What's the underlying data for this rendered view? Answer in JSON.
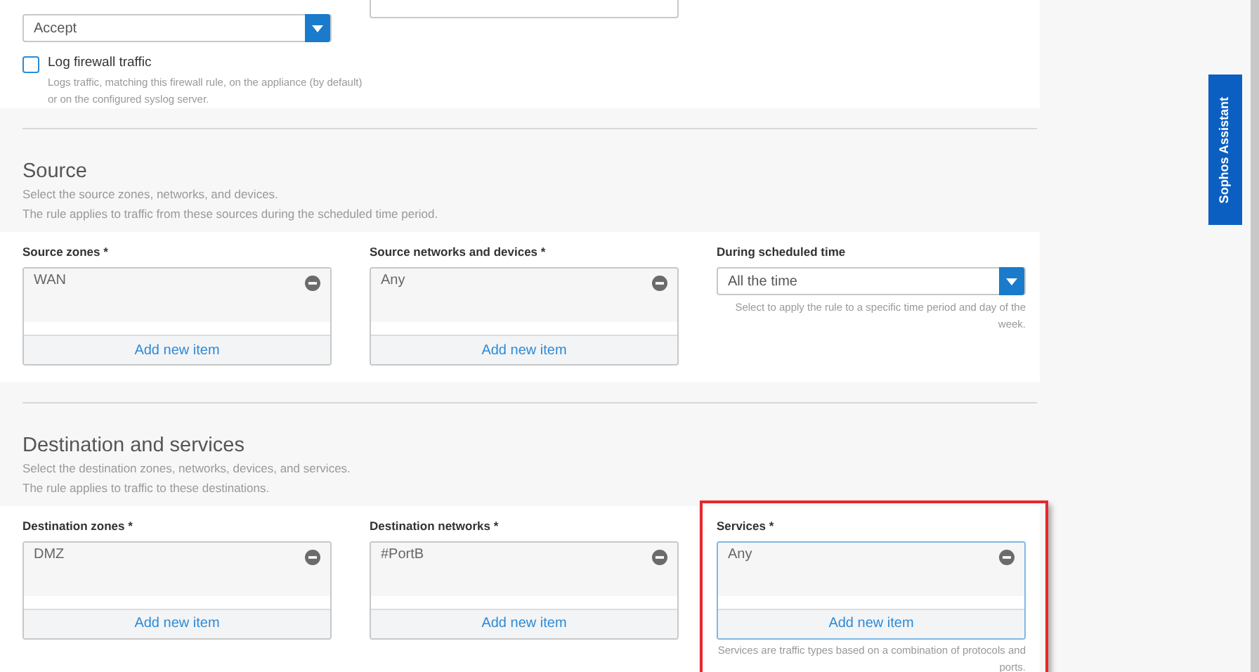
{
  "action": {
    "value": "Accept"
  },
  "log_traffic": {
    "label": "Log firewall traffic",
    "checked": false,
    "help": "Logs traffic, matching this firewall rule, on the appliance (by default) or on the configured syslog server."
  },
  "sections": [
    {
      "title": "Source",
      "description": [
        "Select the source zones, networks, and devices.",
        "The rule applies to traffic from these sources during the scheduled time period."
      ],
      "fields": [
        {
          "kind": "list",
          "label": "Source zones *",
          "items": [
            "WAN"
          ],
          "add": "Add new item",
          "highlighted": false
        },
        {
          "kind": "list",
          "label": "Source networks and devices *",
          "items": [
            "Any"
          ],
          "add": "Add new item",
          "highlighted": false
        },
        {
          "kind": "select",
          "label": "During scheduled time",
          "value": "All the time",
          "help": "Select to apply the rule to a specific time period and day of the week."
        }
      ]
    },
    {
      "title": "Destination and services",
      "description": [
        "Select the destination zones, networks, devices, and services.",
        "The rule applies to traffic to these destinations."
      ],
      "fields": [
        {
          "kind": "list",
          "label": "Destination zones *",
          "items": [
            "DMZ"
          ],
          "add": "Add new item",
          "highlighted": false
        },
        {
          "kind": "list",
          "label": "Destination networks *",
          "items": [
            "#PortB"
          ],
          "add": "Add new item",
          "highlighted": false
        },
        {
          "kind": "list",
          "label": "Services *",
          "items": [
            "Any"
          ],
          "add": "Add new item",
          "highlighted": true,
          "help": "Services are traffic types based on a combination of protocols and ports."
        }
      ]
    }
  ],
  "assistant_tab": "Sophos Assistant"
}
